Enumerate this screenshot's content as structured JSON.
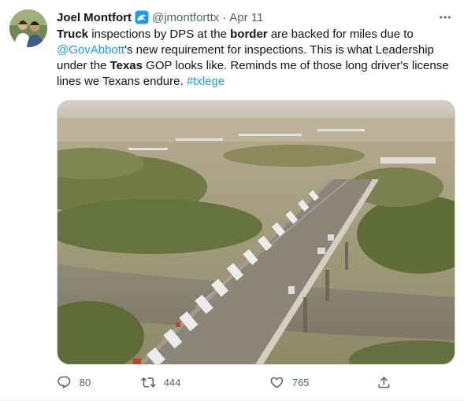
{
  "tweet": {
    "author_name": "Joel Montfort",
    "handle": "@jmontforttx",
    "separator": "·",
    "time": "Apr 11",
    "text_parts": [
      {
        "t": "Truck",
        "style": "bold"
      },
      {
        "t": " inspections by DPS at the ",
        "style": "plain"
      },
      {
        "t": "border",
        "style": "bold"
      },
      {
        "t": " are backed for miles due to ",
        "style": "plain"
      },
      {
        "t": "@GovAbbott",
        "style": "link"
      },
      {
        "t": "'s new requirement for inspections. This is what Leadership under the ",
        "style": "plain"
      },
      {
        "t": "Texas",
        "style": "bold"
      },
      {
        "t": " GOP looks like.  Reminds me of those long driver's license lines we Texans endure. ",
        "style": "plain"
      },
      {
        "t": "#txlege",
        "style": "link"
      }
    ],
    "media": {
      "alt_icon": "photo"
    }
  },
  "actions": {
    "reply_count": "80",
    "retweet_count": "444",
    "like_count": "765"
  },
  "icons": {
    "badge": "wave-badge-icon",
    "more": "more-icon",
    "reply": "reply-icon",
    "retweet": "retweet-icon",
    "like": "heart-icon",
    "share": "share-icon"
  },
  "colors": {
    "link": "#1d9bf0",
    "secondary": "#536471",
    "primary_text": "#0f1419"
  }
}
